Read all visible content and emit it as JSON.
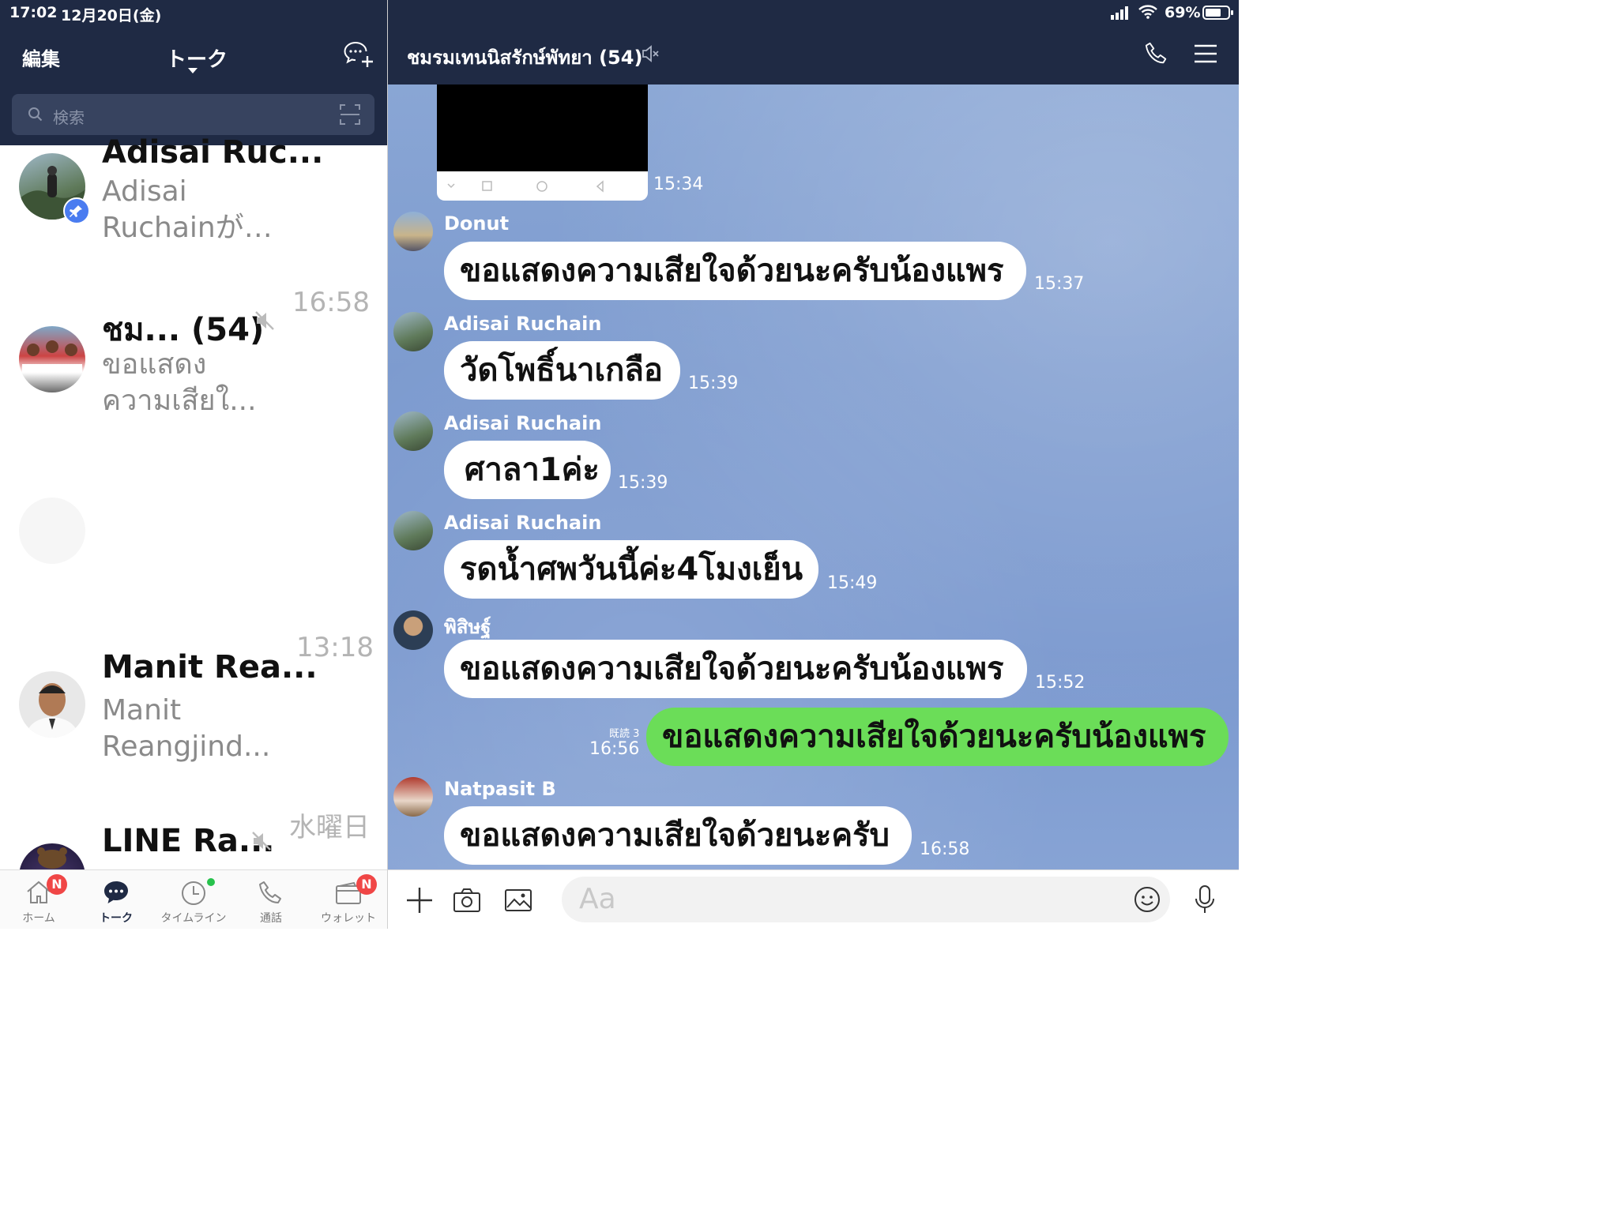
{
  "status": {
    "time": "17:02",
    "date": "12月20日(金)",
    "battery": "69%"
  },
  "left_header": {
    "edit": "編集",
    "title": "トーク"
  },
  "search": {
    "placeholder": "検索"
  },
  "chats": [
    {
      "name": "Adisai Ruc...",
      "msg1": "Adisai",
      "msg2": "Ruchainが…"
    },
    {
      "name": "ชม... (54)",
      "msg1": "ขอแสดง",
      "msg2": "ความเสียใ...",
      "time": "16:58"
    },
    {
      "name": "Manit Rea...",
      "msg1": "Manit",
      "msg2": "Reangjind...",
      "time": "13:18"
    },
    {
      "name": "LINE Ra...",
      "time": "水曜日"
    }
  ],
  "tabs": [
    {
      "label": "ホーム",
      "badge": "N"
    },
    {
      "label": "トーク"
    },
    {
      "label": "タイムライン"
    },
    {
      "label": "通話"
    },
    {
      "label": "ウォレット",
      "badge": "N"
    }
  ],
  "chat_header": {
    "title": "ชมรมเทนนิสรักษ์พัทยา (54)"
  },
  "messages": [
    {
      "time": "15:34"
    },
    {
      "sender": "Donut",
      "text": "ขอแสดงความเสียใจด้วยนะครับน้องแพร",
      "time": "15:37"
    },
    {
      "sender": "Adisai Ruchain",
      "text": "วัดโพธิ์นาเกลือ",
      "time": "15:39"
    },
    {
      "sender": "Adisai Ruchain",
      "text": "ศาลา1ค่ะ",
      "time": "15:39"
    },
    {
      "sender": "Adisai Ruchain",
      "text": "รดน้ำศพวันนี้ค่ะ4โมงเย็น",
      "time": "15:49"
    },
    {
      "sender": "พิสิษฐ์",
      "text": "ขอแสดงความเสียใจด้วยนะครับน้องแพร",
      "time": "15:52"
    },
    {
      "read": "既読 3",
      "text": "ขอแสดงความเสียใจด้วยนะครับน้องแพร",
      "time": "16:56"
    },
    {
      "sender": "Natpasit B",
      "text": "ขอแสดงความเสียใจด้วยนะครับ",
      "time": "16:58"
    }
  ],
  "composer": {
    "placeholder": "Aa"
  },
  "colors": {
    "header": "#1f2a44",
    "my_bubble": "#6bdd58",
    "badge": "#f04646",
    "chat_bg": "#7d9bcf"
  }
}
